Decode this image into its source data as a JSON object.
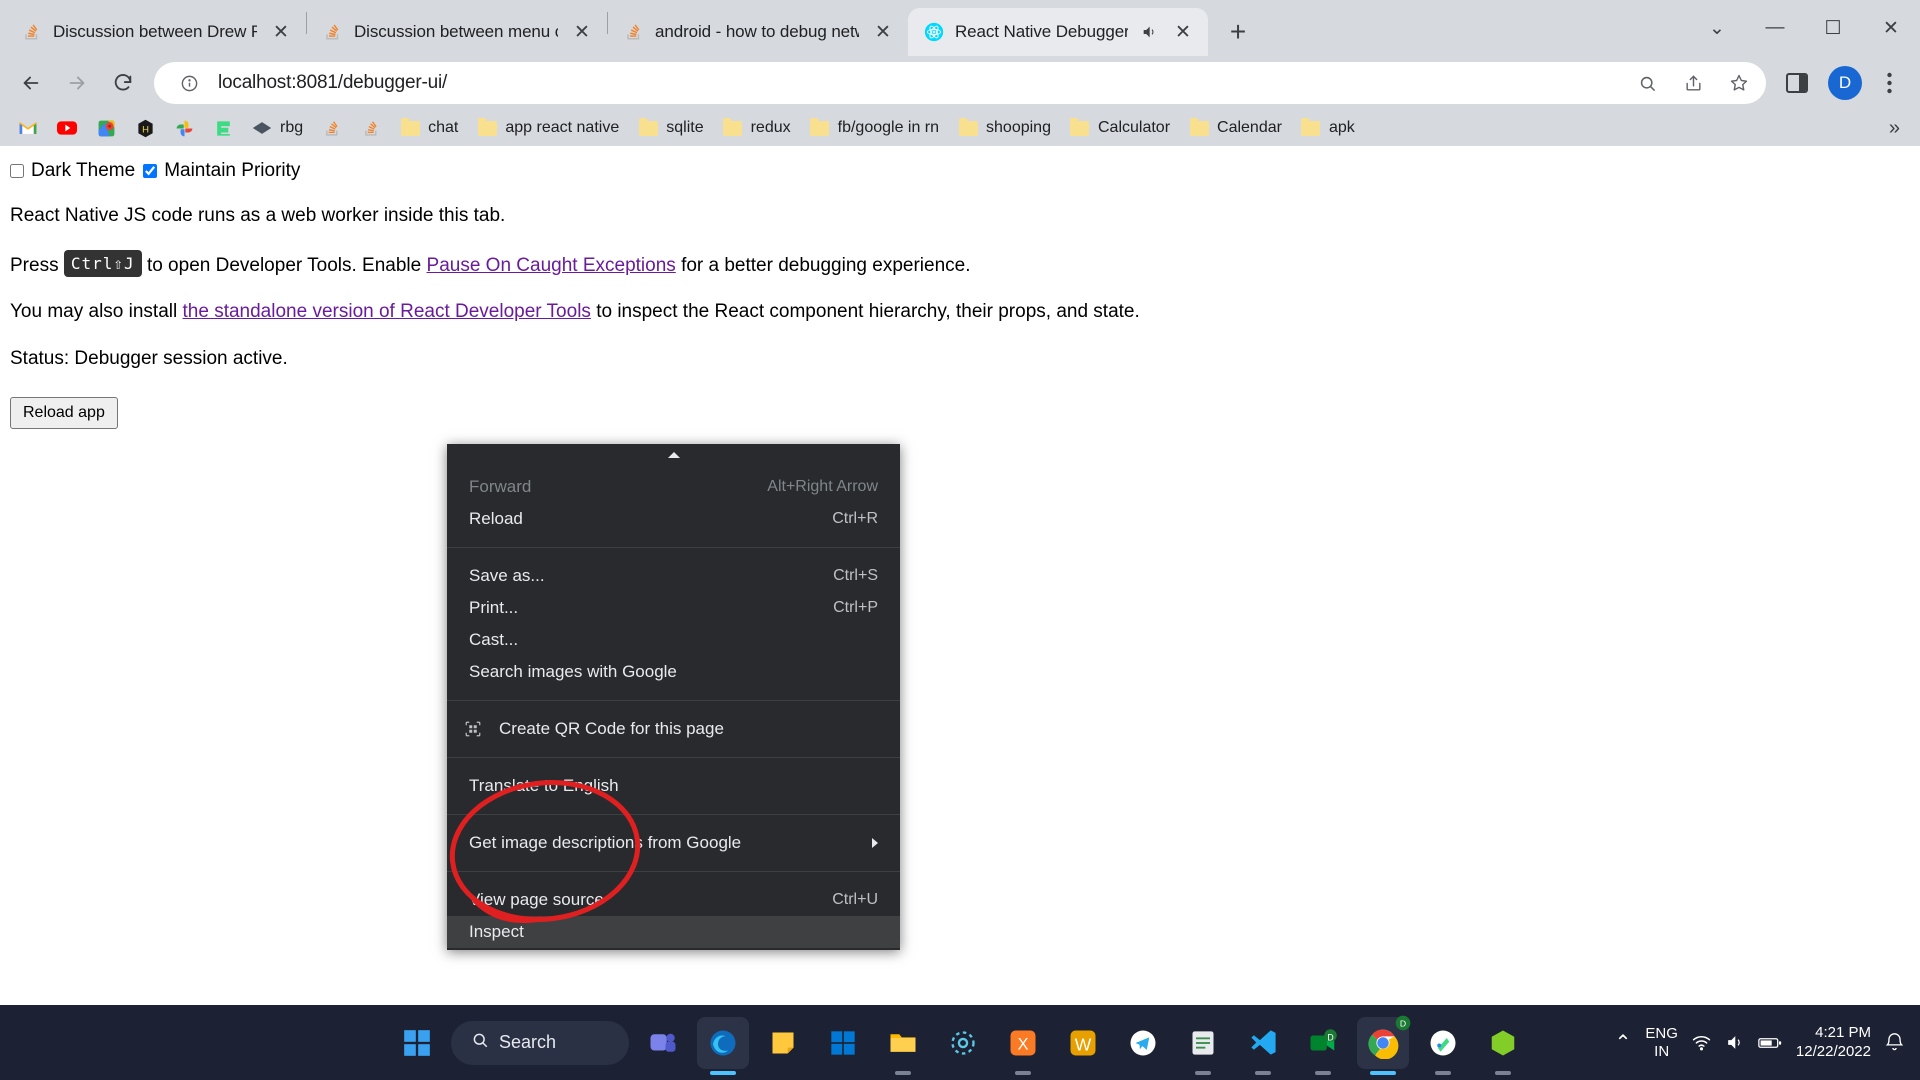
{
  "browser": {
    "tabs": [
      {
        "title": "Discussion between Drew Reese",
        "favicon": "stackoverflow-icon",
        "active": false,
        "audio": false
      },
      {
        "title": "Discussion between menu cd a",
        "favicon": "stackoverflow-icon",
        "active": false,
        "audio": false
      },
      {
        "title": "android - how to debug netwo",
        "favicon": "stackoverflow-icon",
        "active": false,
        "audio": false
      },
      {
        "title": "React Native Debugger",
        "favicon": "react-icon",
        "active": true,
        "audio": true
      }
    ],
    "tab_close_label": "✕",
    "new_tab_label": "+",
    "window_controls": {
      "minimize": "—",
      "maximize": "☐",
      "close": "✕",
      "chevron": "⌄"
    },
    "toolbar": {
      "back": "back-arrow",
      "forward": "forward-arrow",
      "reload": "reload-icon",
      "site_info": "info-icon",
      "url": "localhost:8081/debugger-ui/",
      "zoom_search": "search-icon",
      "share": "share-icon",
      "bookmark_star": "star-icon",
      "side_panel": "side-panel-icon",
      "profile_initial": "D",
      "menu": "three-dot-menu-icon"
    },
    "bookmarks": [
      {
        "label": "",
        "icon": "gmail-icon"
      },
      {
        "label": "",
        "icon": "youtube-icon"
      },
      {
        "label": "",
        "icon": "google-maps-icon"
      },
      {
        "label": "",
        "icon": "hackerrank-icon"
      },
      {
        "label": "",
        "icon": "google-photos-icon"
      },
      {
        "label": "",
        "icon": "envato-icon"
      },
      {
        "label": "rbg",
        "icon": "diamond-icon"
      },
      {
        "label": "",
        "icon": "stackoverflow-icon"
      },
      {
        "label": "",
        "icon": "stackoverflow-icon"
      },
      {
        "label": "chat",
        "icon": "folder-icon"
      },
      {
        "label": "app react native",
        "icon": "folder-icon"
      },
      {
        "label": "sqlite",
        "icon": "folder-icon"
      },
      {
        "label": "redux",
        "icon": "folder-icon"
      },
      {
        "label": "fb/google in rn",
        "icon": "folder-icon"
      },
      {
        "label": "shooping",
        "icon": "folder-icon"
      },
      {
        "label": "Calculator",
        "icon": "folder-icon"
      },
      {
        "label": "Calendar",
        "icon": "folder-icon"
      },
      {
        "label": "apk",
        "icon": "folder-icon"
      }
    ],
    "bookmarks_overflow": "»"
  },
  "page": {
    "dark_theme_label": "Dark Theme",
    "dark_theme_checked": false,
    "maintain_priority_label": "Maintain Priority",
    "maintain_priority_checked": true,
    "line1": "React Native JS code runs as a web worker inside this tab.",
    "line2_pre": "Press",
    "kbd": "Ctrl⇧J",
    "line2_mid": "to open Developer Tools. Enable",
    "line2_link": "Pause On Caught Exceptions",
    "line2_post": "for a better debugging experience.",
    "line3_pre": "You may also install",
    "line3_link": "the standalone version of React Developer Tools",
    "line3_post": "to inspect the React component hierarchy, their props, and state.",
    "status": "Status: Debugger session active.",
    "reload_button": "Reload app"
  },
  "context_menu": {
    "groups": [
      [
        {
          "label": "Forward",
          "accel": "Alt+Right Arrow",
          "disabled": true,
          "icon": "",
          "submenu": false,
          "selected": false
        },
        {
          "label": "Reload",
          "accel": "Ctrl+R",
          "disabled": false,
          "icon": "",
          "submenu": false,
          "selected": false
        }
      ],
      [
        {
          "label": "Save as...",
          "accel": "Ctrl+S",
          "disabled": false,
          "icon": "",
          "submenu": false,
          "selected": false
        },
        {
          "label": "Print...",
          "accel": "Ctrl+P",
          "disabled": false,
          "icon": "",
          "submenu": false,
          "selected": false
        },
        {
          "label": "Cast...",
          "accel": "",
          "disabled": false,
          "icon": "",
          "submenu": false,
          "selected": false
        },
        {
          "label": "Search images with Google",
          "accel": "",
          "disabled": false,
          "icon": "",
          "submenu": false,
          "selected": false
        }
      ],
      [
        {
          "label": "Create QR Code for this page",
          "accel": "",
          "disabled": false,
          "icon": "qr-code-icon",
          "submenu": false,
          "selected": false
        }
      ],
      [
        {
          "label": "Translate to English",
          "accel": "",
          "disabled": false,
          "icon": "",
          "submenu": false,
          "selected": false
        }
      ],
      [
        {
          "label": "Get image descriptions from Google",
          "accel": "",
          "disabled": false,
          "icon": "",
          "submenu": true,
          "selected": false
        }
      ],
      [
        {
          "label": "View page source",
          "accel": "Ctrl+U",
          "disabled": false,
          "icon": "",
          "submenu": false,
          "selected": false
        },
        {
          "label": "Inspect",
          "accel": "",
          "disabled": false,
          "icon": "",
          "submenu": false,
          "selected": true
        }
      ]
    ],
    "annotation_color": "#e02020"
  },
  "taskbar": {
    "search_label": "Search",
    "items": [
      {
        "name": "windows-start-icon",
        "running": false
      },
      {
        "name": "search-pill",
        "running": false
      },
      {
        "name": "teams-icon",
        "running": false
      },
      {
        "name": "edge-icon",
        "running": true
      },
      {
        "name": "sticky-notes-icon",
        "running": false
      },
      {
        "name": "microsoft-store-icon",
        "running": false
      },
      {
        "name": "file-explorer-icon",
        "running": true
      },
      {
        "name": "settings-icon",
        "running": false
      },
      {
        "name": "xampp-icon",
        "running": true
      },
      {
        "name": "whatsapp-w-icon",
        "running": false
      },
      {
        "name": "telegram-icon",
        "running": false
      },
      {
        "name": "notepad-icon",
        "running": true
      },
      {
        "name": "vscode-icon",
        "running": true
      },
      {
        "name": "meet-icon",
        "running": true
      },
      {
        "name": "chrome-icon",
        "running": true
      },
      {
        "name": "android-studio-icon",
        "running": true
      },
      {
        "name": "node-icon",
        "running": true
      }
    ],
    "tray": {
      "chevron": "⌃",
      "lang_line1": "ENG",
      "lang_line2": "IN",
      "wifi": "wifi-icon",
      "volume": "volume-icon",
      "battery": "battery-icon",
      "time": "4:21 PM",
      "date": "12/22/2022",
      "notifications": "notification-icon"
    }
  }
}
